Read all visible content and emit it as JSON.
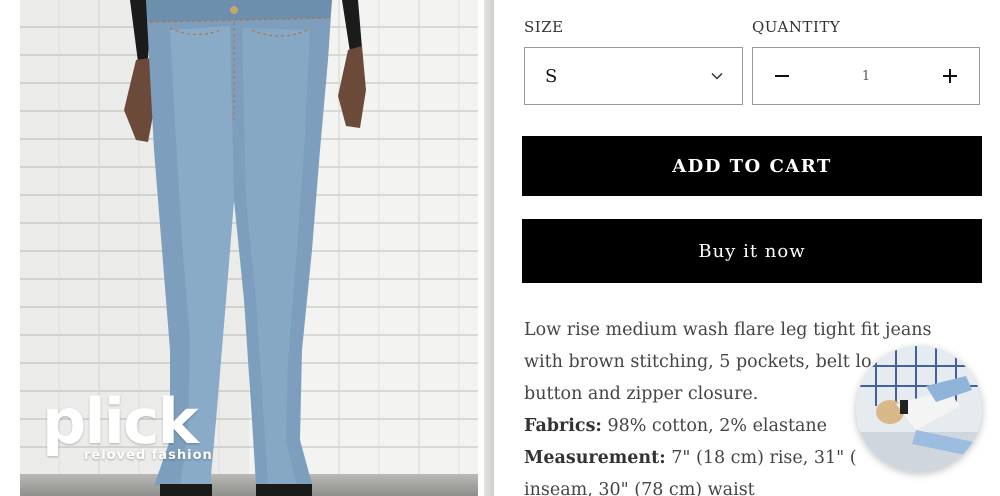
{
  "photo": {
    "alt_subject": "model wearing low rise flare jeans",
    "logo": {
      "word": "plick",
      "tagline": "reloved fashion"
    }
  },
  "product": {
    "size": {
      "label": "SIZE",
      "selected": "S"
    },
    "quantity": {
      "label": "QUANTITY",
      "value": "1",
      "decrement": "−",
      "increment": "+"
    },
    "add_to_cart": "ADD TO CART",
    "buy_now": "Buy it now",
    "description": {
      "intro": "Low rise medium wash flare leg tight fit jeans with brown stitching, 5 pockets, belt lo",
      "intro_end": "button and zipper closure.",
      "fabrics_label": "Fabrics:",
      "fabrics_value": " 98% cotton, 2% elastane",
      "measurement_label": "Measurement:",
      "measurement_value": " 7\" (18 cm) rise, 31\" (",
      "measurement_end": "inseam, 30\" (78 cm) waist"
    }
  },
  "icons": {
    "size_chevron": "chevron-down-icon",
    "minus": "minus-icon",
    "plus": "plus-icon"
  },
  "colors": {
    "button_bg": "#000000",
    "button_text": "#ffffff",
    "border": "#9a9a9a",
    "body_text": "#444444"
  }
}
